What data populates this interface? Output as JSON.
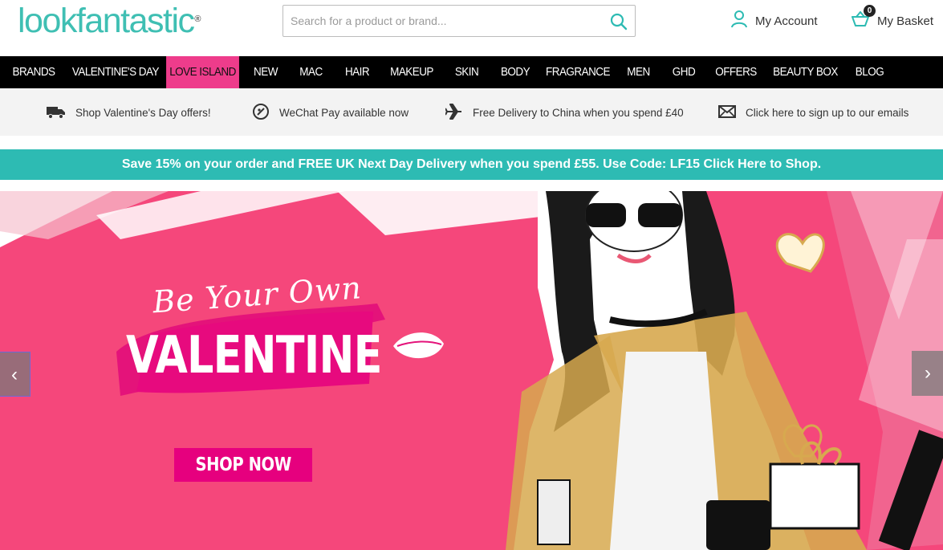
{
  "header": {
    "logo_text": "lookfantastic",
    "logo_mark": "®",
    "search_placeholder": "Search for a product or brand...",
    "account_label": "My Account",
    "basket_label": "My Basket",
    "basket_count": "0"
  },
  "nav": {
    "items": [
      {
        "label": "BRANDS"
      },
      {
        "label": "VALENTINE'S DAY"
      },
      {
        "label": "LOVE ISLAND"
      },
      {
        "label": "NEW"
      },
      {
        "label": "MAC"
      },
      {
        "label": "HAIR"
      },
      {
        "label": "MAKEUP"
      },
      {
        "label": "SKIN"
      },
      {
        "label": "BODY"
      },
      {
        "label": "FRAGRANCE"
      },
      {
        "label": "MEN"
      },
      {
        "label": "GHD"
      },
      {
        "label": "OFFERS"
      },
      {
        "label": "BEAUTY BOX"
      },
      {
        "label": "BLOG"
      }
    ],
    "active_index": 2
  },
  "perks": [
    {
      "icon": "truck-icon",
      "text": "Shop Valentine's Day offers!"
    },
    {
      "icon": "wechat-icon",
      "text": "WeChat Pay available now"
    },
    {
      "icon": "plane-icon",
      "text": "Free Delivery to China when you spend £40"
    },
    {
      "icon": "envelope-icon",
      "text": "Click here to sign up to our emails"
    }
  ],
  "promo": {
    "text": "Save 15% on your order and FREE UK Next Day Delivery when you spend £55. Use Code: LF15  Click Here to Shop."
  },
  "hero": {
    "script_text": "Be Your Own",
    "title": "VALENTINE",
    "cta_label": "SHOP NOW",
    "prev_label": "‹",
    "next_label": "›"
  },
  "colors": {
    "brand_teal": "#2dbbb3",
    "nav_active_pink": "#ee3c8b",
    "hero_pink": "#f5477b",
    "cta_magenta": "#e6007e"
  }
}
